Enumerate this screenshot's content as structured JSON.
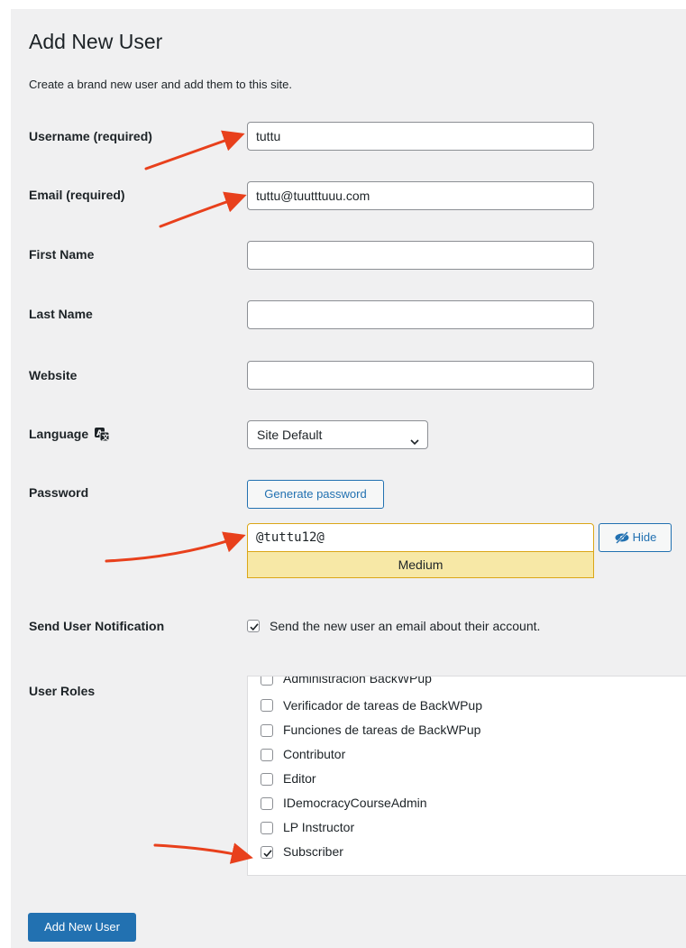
{
  "page": {
    "title": "Add New User",
    "description": "Create a brand new user and add them to this site."
  },
  "fields": {
    "username": {
      "label": "Username (required)",
      "value": "tuttu"
    },
    "email": {
      "label": "Email (required)",
      "value": "tuttu@tuutttuuu.com"
    },
    "first_name": {
      "label": "First Name",
      "value": ""
    },
    "last_name": {
      "label": "Last Name",
      "value": ""
    },
    "website": {
      "label": "Website",
      "value": ""
    },
    "language": {
      "label": "Language",
      "selected": "Site Default",
      "icon": "translation-icon"
    },
    "password": {
      "label": "Password",
      "generate_label": "Generate password",
      "value": "@tuttu12@",
      "hide_label": "Hide",
      "strength": "Medium"
    },
    "notification": {
      "label": "Send User Notification",
      "checkbox_label": "Send the new user an email about their account.",
      "checked": true
    },
    "roles": {
      "label": "User Roles",
      "items": [
        {
          "label": "Administración BackWPup",
          "checked": false
        },
        {
          "label": "Verificador de tareas de BackWPup",
          "checked": false
        },
        {
          "label": "Funciones de tareas de BackWPup",
          "checked": false
        },
        {
          "label": "Contributor",
          "checked": false
        },
        {
          "label": "Editor",
          "checked": false
        },
        {
          "label": "IDemocracyCourseAdmin",
          "checked": false
        },
        {
          "label": "LP Instructor",
          "checked": false
        },
        {
          "label": "Subscriber",
          "checked": true
        }
      ]
    }
  },
  "submit_label": "Add New User",
  "colors": {
    "primary": "#2271b1",
    "background": "#f0f0f1",
    "strength_bg": "#f7e8a6",
    "strength_border": "#dba617",
    "annotation_arrow": "#e8401c"
  }
}
